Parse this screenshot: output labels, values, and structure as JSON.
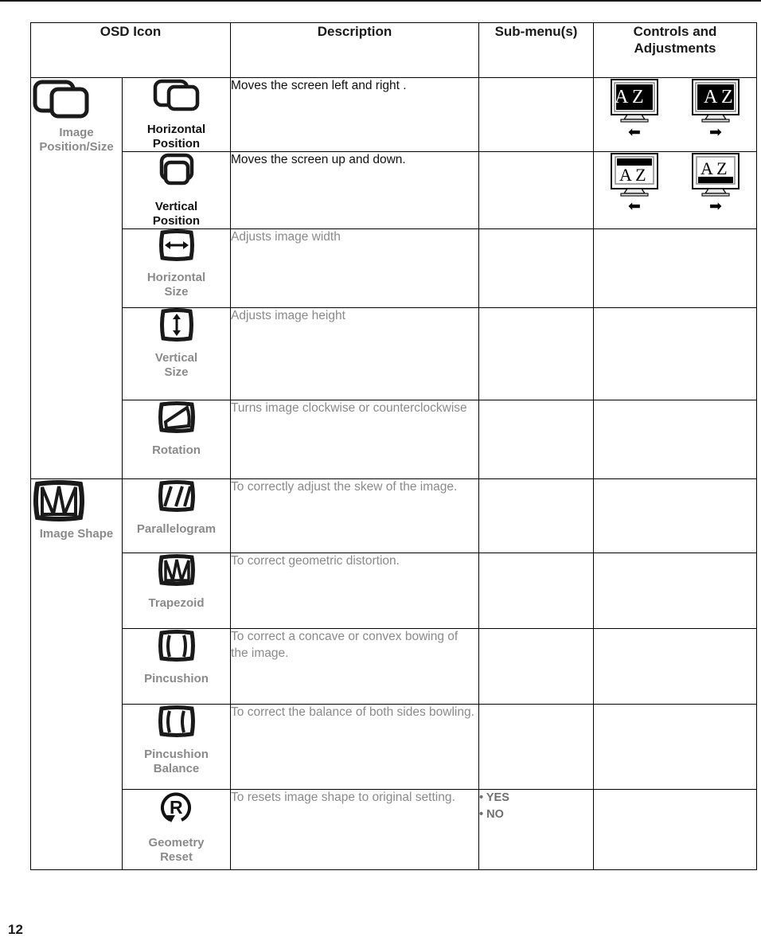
{
  "document": {
    "page_number": "12"
  },
  "table": {
    "headers": [
      {
        "label": "OSD Icon",
        "name": "header-osd-icon"
      },
      {
        "label": "Description",
        "name": "header-description"
      },
      {
        "label": "Sub-menu(s)",
        "name": "header-sub-menus"
      },
      {
        "label": "Controls and Adjustments",
        "name": "header-controls-adjustments"
      }
    ],
    "groups": [
      {
        "label": "Image\nPosition/Size",
        "label_line1": "Image",
        "label_line2": "Position/Size",
        "icon": "image-position-size-icon"
      },
      {
        "label": "Image Shape",
        "label_line1": "Image Shape",
        "label_line2": "",
        "icon": "image-shape-icon"
      }
    ],
    "rows": [
      {
        "icon": "horizontal-position-icon",
        "icon_label_line1": "Horizontal",
        "icon_label_line2": "Position",
        "label_dark": true,
        "description": "Moves the screen left and right .",
        "description_dark": true,
        "submenus": [],
        "controls": "horizontal-position-monitors"
      },
      {
        "icon": "vertical-position-icon",
        "icon_label_line1": "Vertical",
        "icon_label_line2": "Position",
        "label_dark": true,
        "description": "Moves the screen up and down.",
        "description_dark": true,
        "submenus": [],
        "controls": "vertical-position-monitors"
      },
      {
        "icon": "horizontal-size-icon",
        "icon_label_line1": "Horizontal",
        "icon_label_line2": "Size",
        "label_dark": false,
        "description": "Adjusts image width",
        "description_dark": false,
        "submenus": [],
        "controls": ""
      },
      {
        "icon": "vertical-size-icon",
        "icon_label_line1": "Vertical",
        "icon_label_line2": "Size",
        "label_dark": false,
        "description": "Adjusts image height",
        "description_dark": false,
        "submenus": [],
        "controls": ""
      },
      {
        "icon": "rotation-icon",
        "icon_label_line1": "Rotation",
        "icon_label_line2": "",
        "label_dark": false,
        "description": "Turns image clockwise or counterclockwise",
        "description_dark": false,
        "submenus": [],
        "controls": ""
      },
      {
        "icon": "parallelogram-icon",
        "icon_label_line1": "Parallelogram",
        "icon_label_line2": "",
        "label_dark": false,
        "description": "To correctly adjust the skew of the image.",
        "description_dark": false,
        "submenus": [],
        "controls": ""
      },
      {
        "icon": "trapezoid-icon",
        "icon_label_line1": "Trapezoid",
        "icon_label_line2": "",
        "label_dark": false,
        "description": "To correct geometric distortion.",
        "description_dark": false,
        "submenus": [],
        "controls": ""
      },
      {
        "icon": "pincushion-icon",
        "icon_label_line1": "Pincushion",
        "icon_label_line2": "",
        "label_dark": false,
        "description": "To correct a concave or convex bowing of the image.",
        "description_dark": false,
        "submenus": [],
        "controls": ""
      },
      {
        "icon": "pincushion-balance-icon",
        "icon_label_line1": "Pincushion",
        "icon_label_line2": "Balance",
        "label_dark": false,
        "description": "To correct the balance of both sides bowling.",
        "description_dark": false,
        "submenus": [],
        "controls": ""
      },
      {
        "icon": "geometry-reset-icon",
        "icon_label_line1": "Geometry",
        "icon_label_line2": "Reset",
        "label_dark": false,
        "description": "To resets image shape to original setting.",
        "description_dark": false,
        "submenus": [
          "• YES",
          "• NO"
        ],
        "controls": ""
      }
    ]
  },
  "controls_illustrations": {
    "horizontal_position": {
      "left_monitor": {
        "screen_text": "A Z",
        "text_align": "left",
        "arrow": "◀"
      },
      "right_monitor": {
        "screen_text": "A Z",
        "text_align": "right",
        "arrow": "▶"
      },
      "arrow_left": "➡",
      "arrow_right": "➡"
    },
    "vertical_position": {
      "left_monitor": {
        "screen_text": "A Z",
        "text_valign": "bottom",
        "arrow": "◀"
      },
      "right_monitor": {
        "screen_text": "A Z",
        "text_valign": "top",
        "arrow": "▶"
      }
    }
  },
  "colors": {
    "border": "#000000",
    "text_black": "#111111",
    "text_gray": "#8a8a8a",
    "submenu_gray": "#6f6f6f"
  }
}
